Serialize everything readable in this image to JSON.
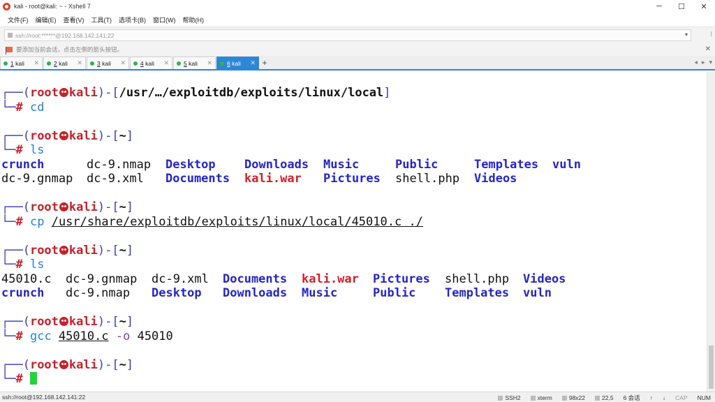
{
  "window": {
    "title": "kali - root@kali: ~ - Xshell 7",
    "minimize": "─",
    "maximize": "☐",
    "close": "✕"
  },
  "menu": [
    "文件(F)",
    "编辑(E)",
    "查看(V)",
    "工具(T)",
    "选项卡(B)",
    "窗口(W)",
    "帮助(H)"
  ],
  "address": {
    "value": "ssh://root:******@192.168.142.141:22",
    "dropdown": "▾"
  },
  "hint": {
    "text": "要添加当前会话，点击左侧的箭头按钮。",
    "close": "✕"
  },
  "tabs": [
    {
      "num": "1",
      "name": " kali",
      "active": false
    },
    {
      "num": "2",
      "name": " kali",
      "active": false
    },
    {
      "num": "3",
      "name": " kali",
      "active": false
    },
    {
      "num": "4",
      "name": " kali",
      "active": false
    },
    {
      "num": "5",
      "name": " kali",
      "active": false
    },
    {
      "num": "6",
      "name": " kali",
      "active": true
    }
  ],
  "tab_add": "+",
  "terminal": {
    "prompt_user": "root",
    "prompt_host": "kali",
    "blocks": [
      {
        "path": "/usr/…/exploitdb/exploits/linux/local",
        "cmd": "cd",
        "args": ""
      },
      {
        "path": "~",
        "cmd": "ls",
        "args": ""
      },
      {
        "path": "~",
        "cmd": "cp",
        "args": "/usr/share/exploitdb/exploits/linux/local/45010.c ./"
      },
      {
        "path": "~",
        "cmd": "ls",
        "args": ""
      },
      {
        "path": "~",
        "cmd": "gcc",
        "args": "45010.c -o 45010"
      },
      {
        "path": "~",
        "cmd": "",
        "args": ""
      }
    ],
    "ls1": [
      [
        "crunch",
        "dc-9.nmap",
        "Desktop",
        "Downloads",
        "Music",
        "Public",
        "Templates",
        "vuln"
      ],
      [
        "dc-9.gnmap",
        "dc-9.xml",
        "Documents",
        "kali.war",
        "Pictures",
        "shell.php",
        "Videos"
      ]
    ],
    "ls2": [
      [
        "45010.c",
        "dc-9.gnmap",
        "dc-9.xml",
        "Documents",
        "kali.war",
        "Pictures",
        "shell.php",
        "Videos"
      ],
      [
        "crunch",
        "dc-9.nmap",
        "Desktop",
        "Downloads",
        "Music",
        "Public",
        "Templates",
        "vuln"
      ]
    ],
    "gcc_file": "45010.c",
    "gcc_opt": "-o",
    "gcc_out": "45010"
  },
  "status": {
    "connection": "ssh://root@192.168.142.141:22",
    "protocol": "SSH2",
    "term": "xterm",
    "size": "98x22",
    "pos": "22,5",
    "sessions": "6 会话",
    "cap": "CAP",
    "num": "NUM"
  }
}
